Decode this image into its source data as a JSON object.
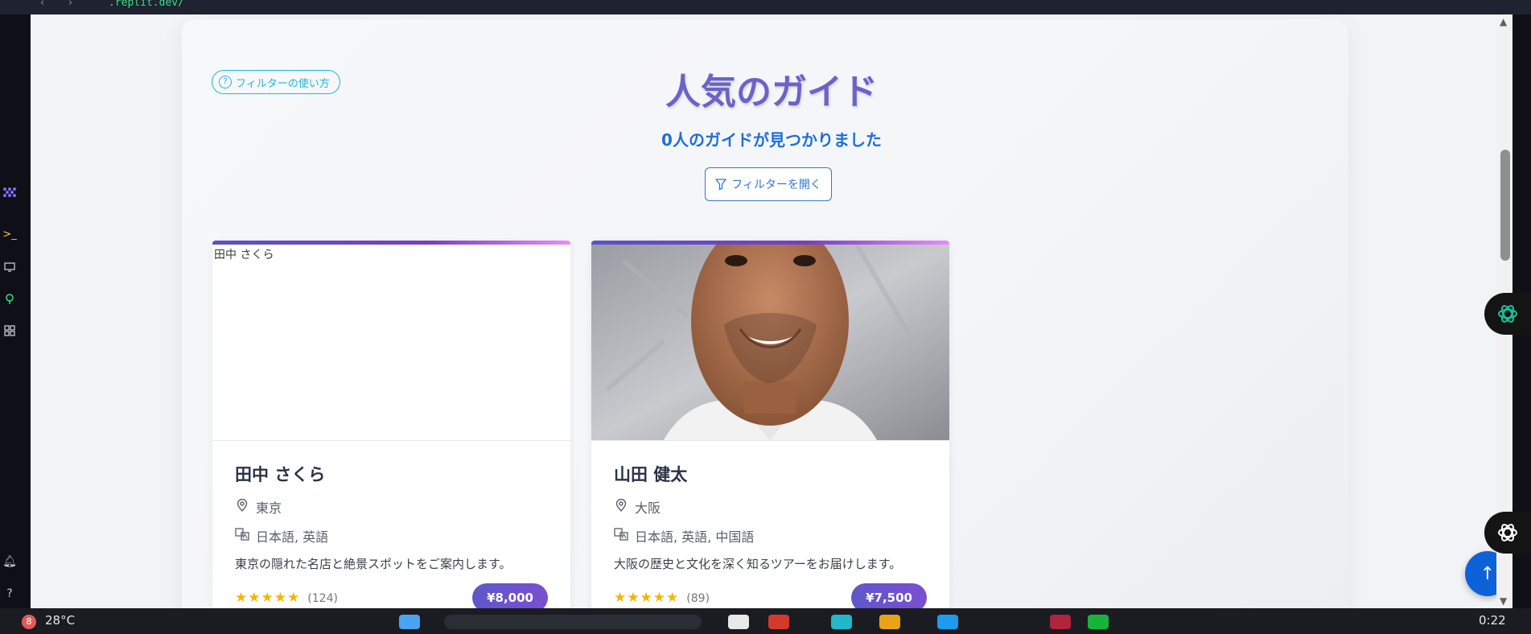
{
  "browser": {
    "address": ".replit.dev/",
    "back_icon": "‹",
    "forward_icon": "›"
  },
  "page": {
    "help_label": "フィルターの使い方",
    "title": "人気のガイド",
    "results": "0人のガイドが見つかりました",
    "filter_button": "フィルターを開く"
  },
  "guides": [
    {
      "name": "田中 さくら",
      "image_alt": "田中 さくら",
      "location": "東京",
      "languages": "日本語, 英語",
      "description": "東京の隠れた名店と絶景スポットをご案内します。",
      "rating_stars": "★★★★★",
      "rating": 5,
      "reviews": "(124)",
      "price": "¥8,000"
    },
    {
      "name": "山田 健太",
      "image_alt": "山田 健太",
      "location": "大阪",
      "languages": "日本語, 英語, 中国語",
      "description": "大阪の歴史と文化を深く知るツアーをお届けします。",
      "rating_stars": "★★★★★",
      "rating": 5,
      "reviews": "(89)",
      "price": "¥7,500"
    }
  ],
  "taskbar": {
    "temperature": "28°C",
    "notification_count": "8",
    "time": "0:22"
  },
  "colors": {
    "title": "#6b63c9",
    "results": "#1e6fd9",
    "accent_cyan": "#1fb8d6",
    "price_pill": "#6a5acd",
    "back_to_top": "#0d62d9"
  }
}
